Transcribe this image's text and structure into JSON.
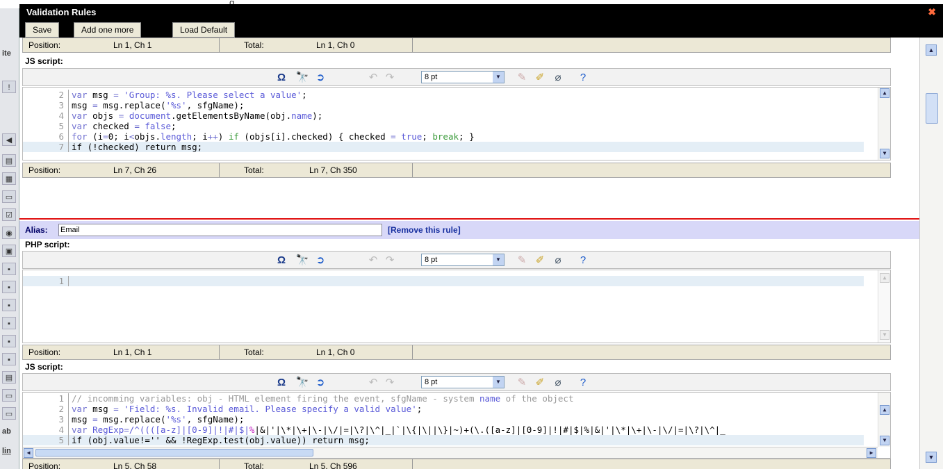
{
  "window": {
    "title": "Validation Rules",
    "close_glyph": "✖"
  },
  "background": {
    "top_text": "g"
  },
  "left_strip": {
    "text1": "ite",
    "text2": "ab",
    "text3": "lin"
  },
  "toolbar": {
    "save": "Save",
    "add_more": "Add one more",
    "load_default": "Load Default"
  },
  "editor_toolbar": {
    "font_size": "8 pt",
    "icons": [
      "omega-icon",
      "find-icon",
      "go-icon",
      "undo-icon",
      "redo-icon",
      "font-size-select",
      "search-replace-icon",
      "highlight-icon",
      "reset-icon",
      "help-icon"
    ]
  },
  "status_labels": {
    "position": "Position:",
    "total": "Total:"
  },
  "top_php_status": {
    "position": "Ln 1, Ch 1",
    "total": "Ln 1, Ch 0"
  },
  "js1": {
    "label": "JS script:",
    "status_position": "Ln 7, Ch 26",
    "status_total": "Ln 7, Ch 350",
    "lines": [
      {
        "n": "2",
        "parts": [
          {
            "c": "k",
            "t": "var "
          },
          {
            "t": "msg "
          },
          {
            "c": "k",
            "t": "= "
          },
          {
            "c": "s",
            "t": "'Group: %s. Please select a value'"
          },
          {
            "t": ";"
          }
        ]
      },
      {
        "n": "3",
        "parts": [
          {
            "t": "msg "
          },
          {
            "c": "k",
            "t": "= "
          },
          {
            "t": "msg.replace("
          },
          {
            "c": "s",
            "t": "'%s'"
          },
          {
            "t": ", sfgName);"
          }
        ]
      },
      {
        "n": "4",
        "parts": [
          {
            "c": "k",
            "t": "var "
          },
          {
            "t": "objs "
          },
          {
            "c": "k",
            "t": "= "
          },
          {
            "c": "s",
            "t": "document"
          },
          {
            "t": ".getElementsByName(obj."
          },
          {
            "c": "s",
            "t": "name"
          },
          {
            "t": ");"
          }
        ]
      },
      {
        "n": "5",
        "parts": [
          {
            "c": "k",
            "t": "var "
          },
          {
            "t": "checked "
          },
          {
            "c": "k",
            "t": "= "
          },
          {
            "c": "s",
            "t": "false"
          },
          {
            "t": ";"
          }
        ]
      },
      {
        "n": "6",
        "parts": [
          {
            "c": "k",
            "t": "for "
          },
          {
            "t": "(i"
          },
          {
            "c": "k",
            "t": "="
          },
          {
            "t": "0; i"
          },
          {
            "c": "k",
            "t": "<"
          },
          {
            "t": "objs."
          },
          {
            "c": "s",
            "t": "length"
          },
          {
            "t": "; i"
          },
          {
            "c": "k",
            "t": "++"
          },
          {
            "t": ") "
          },
          {
            "c": "g",
            "t": "if "
          },
          {
            "t": "(objs[i].checked) { checked "
          },
          {
            "c": "k",
            "t": "= "
          },
          {
            "c": "s",
            "t": "true"
          },
          {
            "t": "; "
          },
          {
            "c": "g",
            "t": "break"
          },
          {
            "t": "; }"
          }
        ]
      },
      {
        "n": "7",
        "parts": [
          {
            "t": "if (!checked) return msg;"
          }
        ]
      }
    ]
  },
  "rule2": {
    "alias_label": "Alias:",
    "alias_value": "Email",
    "remove_link": "[Remove this rule]"
  },
  "php2": {
    "label": "PHP script:",
    "line_number": "1",
    "status_position": "Ln 1, Ch 1",
    "status_total": "Ln 1, Ch 0"
  },
  "js2": {
    "label": "JS script:",
    "status_position": "Ln 5, Ch 58",
    "status_total": "Ln 5, Ch 596",
    "lines": [
      {
        "n": "1",
        "parts": [
          {
            "c": "c",
            "t": "// incomming variables: obj - HTML element firing the event, sfgName - system "
          },
          {
            "c": "s",
            "t": "name"
          },
          {
            "c": "c",
            "t": " of the object"
          }
        ]
      },
      {
        "n": "2",
        "parts": [
          {
            "c": "k",
            "t": "var "
          },
          {
            "t": "msg "
          },
          {
            "c": "k",
            "t": "= "
          },
          {
            "c": "s",
            "t": "'Field: %s. Invalid email. Please specify a valid value'"
          },
          {
            "t": ";"
          }
        ]
      },
      {
        "n": "3",
        "parts": [
          {
            "t": "msg "
          },
          {
            "c": "k",
            "t": "= "
          },
          {
            "t": "msg.replace("
          },
          {
            "c": "s",
            "t": "'%s'"
          },
          {
            "t": ", sfgName);"
          }
        ]
      },
      {
        "n": "4",
        "parts": [
          {
            "c": "k",
            "t": "var "
          },
          {
            "c": "s",
            "t": "RegExp"
          },
          {
            "c": "k",
            "t": "="
          },
          {
            "c": "s",
            "t": "/^((([a-z]|[0-9]|!|#|$|"
          },
          {
            "c": "p",
            "t": "%"
          },
          {
            "t": "|&|'|\\*|\\+|\\-|\\/|=|\\?|\\^|_|`|\\{|\\||\\}|~)+(\\.([a-z]|[0-9]|!|#|$|%|&|'|\\*|\\+|\\-|\\/|=|\\?|\\^|_"
          }
        ]
      },
      {
        "n": "5",
        "parts": [
          {
            "t": "if (obj.value!='' && !RegExp.test(obj.value)) return msg;"
          }
        ]
      }
    ]
  }
}
